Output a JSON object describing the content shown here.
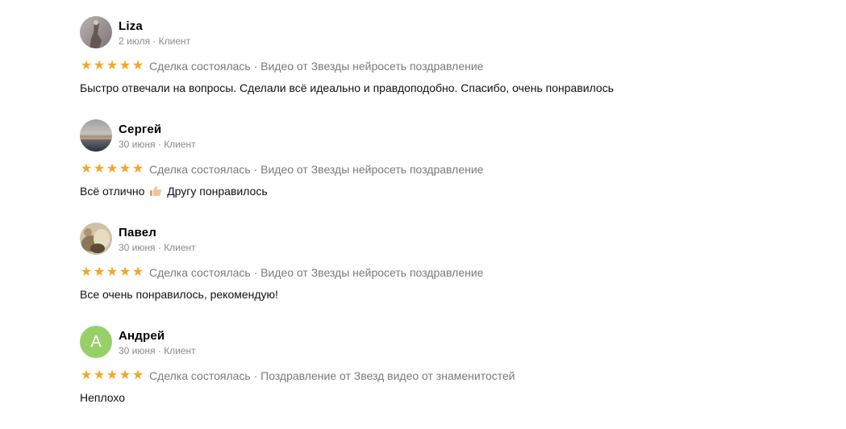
{
  "reviews": [
    {
      "name": "Liza",
      "date": "2 июля",
      "role": "Клиент",
      "deal": "Сделка состоялась · Видео от Звезды нейросеть поздравление",
      "text": "Быстро отвечали на вопросы. Сделали всё идеально и правдоподобно. Спасибо, очень понравилось",
      "rating": 5,
      "avatar": "photo"
    },
    {
      "name": "Сергей",
      "date": "30 июня",
      "role": "Клиент",
      "deal": "Сделка состоялась · Видео от Звезды нейросеть поздравление",
      "text_before": "Всё отлично",
      "text_emoji": "thumbs-up-icon",
      "text_after": "Другу понравилось",
      "rating": 5,
      "avatar": "photo"
    },
    {
      "name": "Павел",
      "date": "30 июня",
      "role": "Клиент",
      "deal": "Сделка состоялась · Видео от Звезды нейросеть поздравление",
      "text": "Все очень понравилось, рекомендую!",
      "rating": 5,
      "avatar": "photo"
    },
    {
      "name": "Андрей",
      "date": "30 июня",
      "role": "Клиент",
      "deal": "Сделка состоялась · Поздравление от Звезд видео от знаменитостей",
      "text": "Неплохо",
      "rating": 5,
      "avatar_letter": "А",
      "avatar_color": "#97cf69"
    }
  ],
  "star_color": "#f5a623",
  "meta_separator": " · "
}
